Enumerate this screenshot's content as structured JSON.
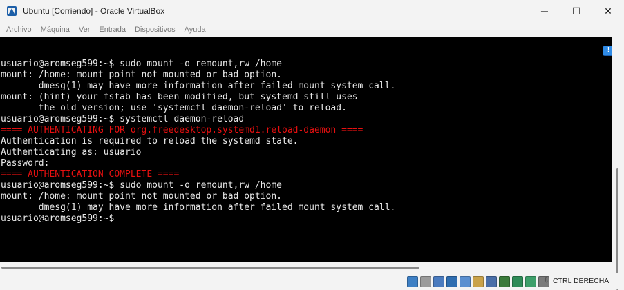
{
  "window": {
    "title": "Ubuntu [Corriendo] - Oracle VirtualBox",
    "app_icon": "virtualbox-icon",
    "controls": {
      "minimize": "─",
      "maximize": "☐",
      "close": "✕"
    }
  },
  "menu": {
    "items": [
      "Archivo",
      "Máquina",
      "Ver",
      "Entrada",
      "Dispositivos",
      "Ayuda"
    ]
  },
  "terminal": {
    "lines": [
      {
        "text": "usuario@aromseg599:~$ sudo mount -o remount,rw /home",
        "color": "#e8e8e8"
      },
      {
        "text": "mount: /home: mount point not mounted or bad option.",
        "color": "#e8e8e8"
      },
      {
        "text": "       dmesg(1) may have more information after failed mount system call.",
        "color": "#e8e8e8"
      },
      {
        "text": "mount: (hint) your fstab has been modified, but systemd still uses",
        "color": "#e8e8e8"
      },
      {
        "text": "       the old version; use 'systemctl daemon-reload' to reload.",
        "color": "#e8e8e8"
      },
      {
        "text": "usuario@aromseg599:~$ systemctl daemon-reload",
        "color": "#e8e8e8"
      },
      {
        "text": "==== AUTHENTICATING FOR org.freedesktop.systemd1.reload-daemon ====",
        "color": "#e81010"
      },
      {
        "text": "Authentication is required to reload the systemd state.",
        "color": "#e8e8e8"
      },
      {
        "text": "Authenticating as: usuario",
        "color": "#e8e8e8"
      },
      {
        "text": "Password:",
        "color": "#e8e8e8"
      },
      {
        "text": "==== AUTHENTICATION COMPLETE ====",
        "color": "#e81010"
      },
      {
        "text": "usuario@aromseg599:~$ sudo mount -o remount,rw /home",
        "color": "#e8e8e8"
      },
      {
        "text": "mount: /home: mount point not mounted or bad option.",
        "color": "#e8e8e8"
      },
      {
        "text": "       dmesg(1) may have more information after failed mount system call.",
        "color": "#e8e8e8"
      },
      {
        "text": "usuario@aromseg599:~$",
        "color": "#e8e8e8"
      }
    ]
  },
  "notification": {
    "icon": "notification-icon"
  },
  "statusbar": {
    "icons": [
      {
        "name": "hard-disk-icon",
        "color": "#3d7fc4"
      },
      {
        "name": "optical-drive-icon",
        "color": "#9a9a9a"
      },
      {
        "name": "audio-icon",
        "color": "#4a7bbf"
      },
      {
        "name": "network-icon",
        "color": "#2e6db0"
      },
      {
        "name": "usb-icon",
        "color": "#5a8fd0"
      },
      {
        "name": "shared-folders-icon",
        "color": "#c9a24a"
      },
      {
        "name": "display-icon",
        "color": "#4a6fa8"
      },
      {
        "name": "video-capture-icon",
        "color": "#3a7a3a"
      },
      {
        "name": "cpu-icon",
        "color": "#2e8b57"
      },
      {
        "name": "guest-additions-icon",
        "color": "#3d9f6a"
      },
      {
        "name": "mouse-integration-icon",
        "color": "#7a7a7a"
      }
    ],
    "host_key_arrow": "⇩",
    "host_key": "CTRL DERECHA"
  }
}
